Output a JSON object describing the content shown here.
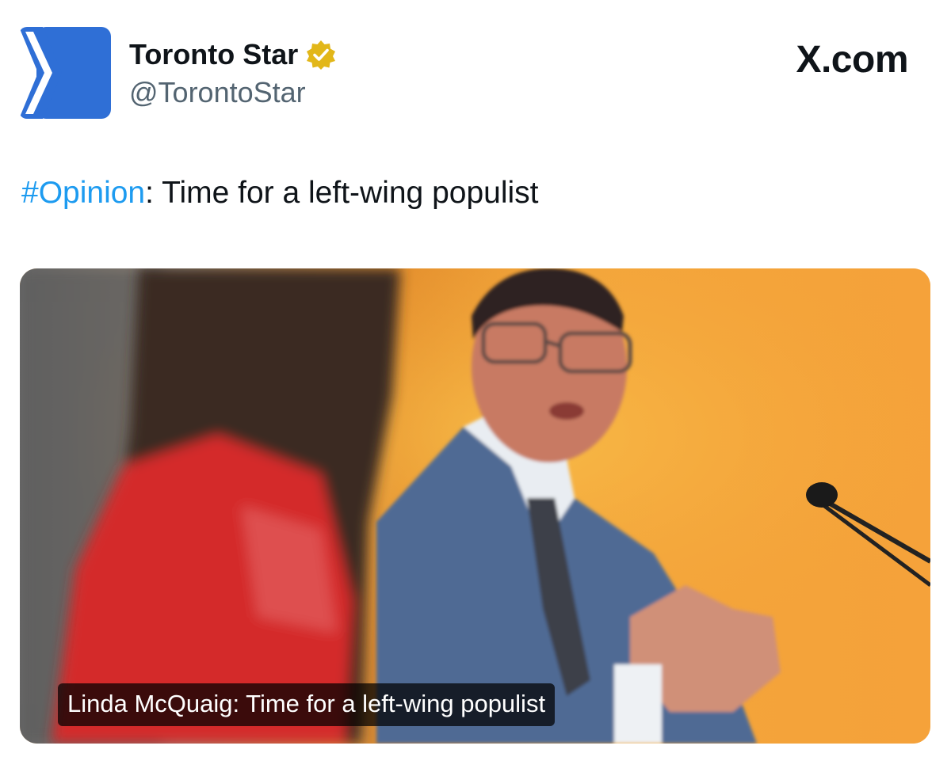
{
  "author": {
    "name": "Toronto Star",
    "handle": "@TorontoStar",
    "verified_icon": "verified-badge-icon",
    "avatar_icon": "toronto-star-logo-icon"
  },
  "brand": "X.com",
  "tweet": {
    "hashtag": "#Opinion",
    "text": ": Time for a left-wing populist"
  },
  "media": {
    "caption": "Linda McQuaig: Time for a left-wing populist"
  },
  "colors": {
    "hashtag": "#1d9bf0",
    "avatar": "#2f6fd6",
    "verified": "#e2b719"
  }
}
